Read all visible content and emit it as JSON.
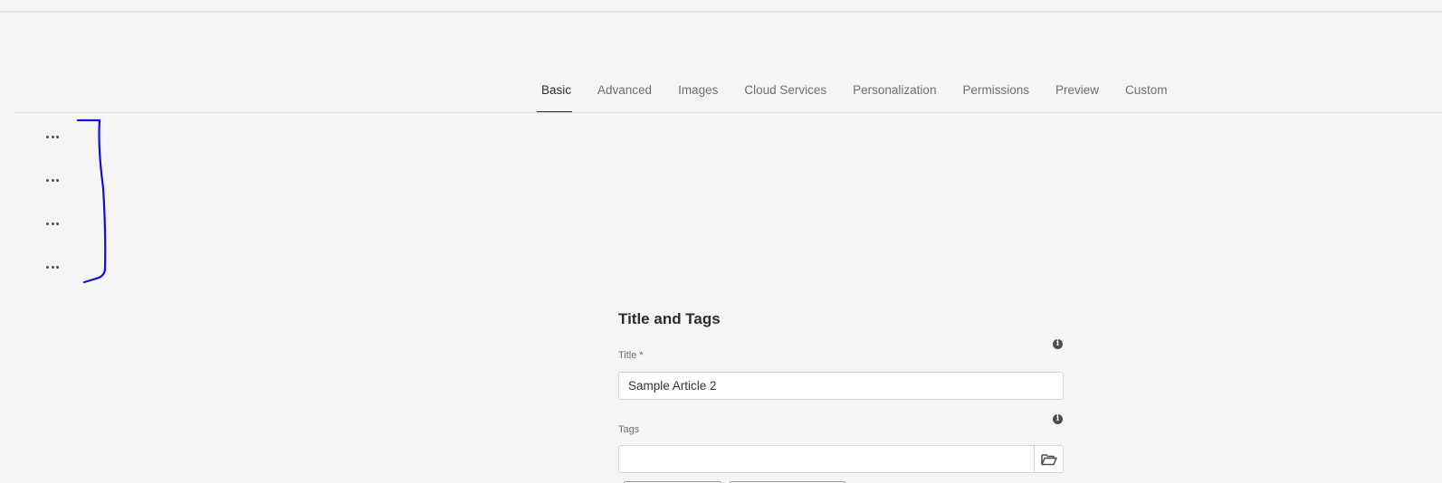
{
  "tabs": [
    {
      "label": "Basic",
      "active": true
    },
    {
      "label": "Advanced",
      "active": false
    },
    {
      "label": "Images",
      "active": false
    },
    {
      "label": "Cloud Services",
      "active": false
    },
    {
      "label": "Personalization",
      "active": false
    },
    {
      "label": "Permissions",
      "active": false
    },
    {
      "label": "Preview",
      "active": false
    },
    {
      "label": "Custom",
      "active": false
    }
  ],
  "side_actions": [
    {
      "icon": "more-icon"
    },
    {
      "icon": "more-icon"
    },
    {
      "icon": "more-icon"
    },
    {
      "icon": "more-icon"
    }
  ],
  "annotation": {
    "color": "#1010d0"
  },
  "form": {
    "section_title": "Title and Tags",
    "title_label": "Title *",
    "title_value": "Sample Article 2",
    "tags_label": "Tags",
    "tags_value": "",
    "info_glyph": "i",
    "tags_picker_icon": "folder-open-icon"
  },
  "colors": {
    "background": "#f5f5f5",
    "active_tab_underline": "#2c2c2c"
  }
}
